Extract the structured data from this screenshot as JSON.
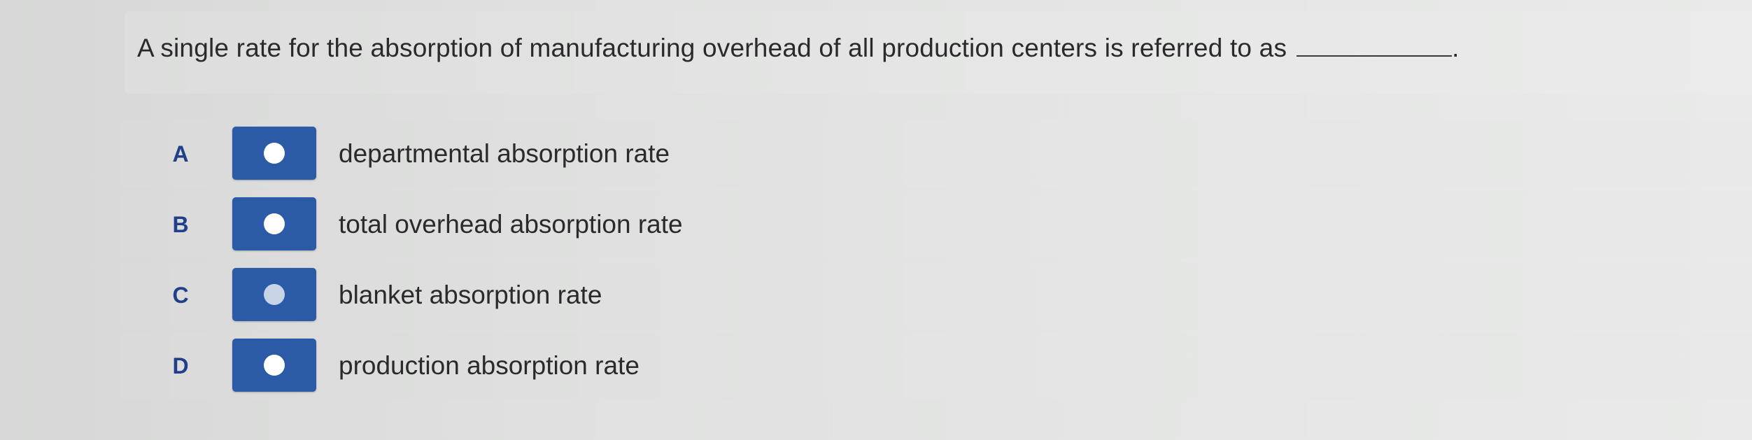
{
  "question": {
    "text": "A single rate for the absorption of manufacturing overhead of all production centers is referred to as",
    "trailing_punctuation": "."
  },
  "options": [
    {
      "letter": "A",
      "label": "departmental absorption rate"
    },
    {
      "letter": "B",
      "label": "total overhead absorption rate"
    },
    {
      "letter": "C",
      "label": "blanket absorption rate"
    },
    {
      "letter": "D",
      "label": "production absorption rate"
    }
  ],
  "colors": {
    "radio_button": "#2b5aa6",
    "letter": "#1f3f8a"
  }
}
